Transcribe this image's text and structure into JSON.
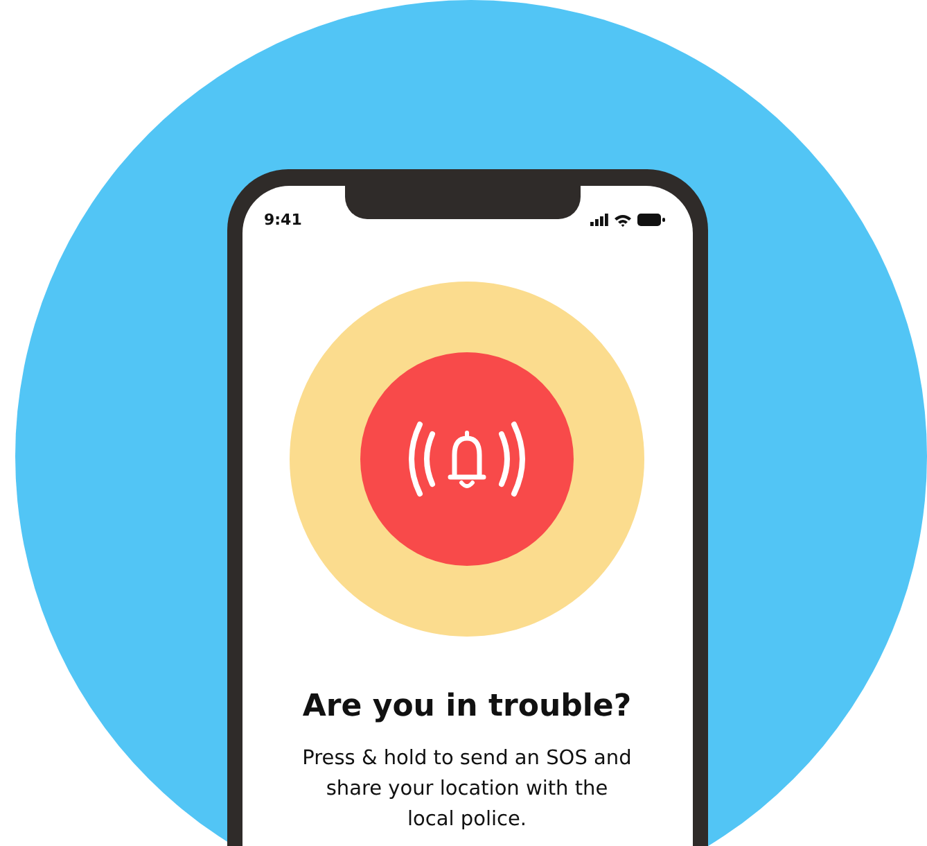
{
  "status_bar": {
    "time": "9:41"
  },
  "prompt": {
    "title": "Are you in trouble?",
    "message": "Press & hold to send an SOS and share your location with the local police."
  }
}
